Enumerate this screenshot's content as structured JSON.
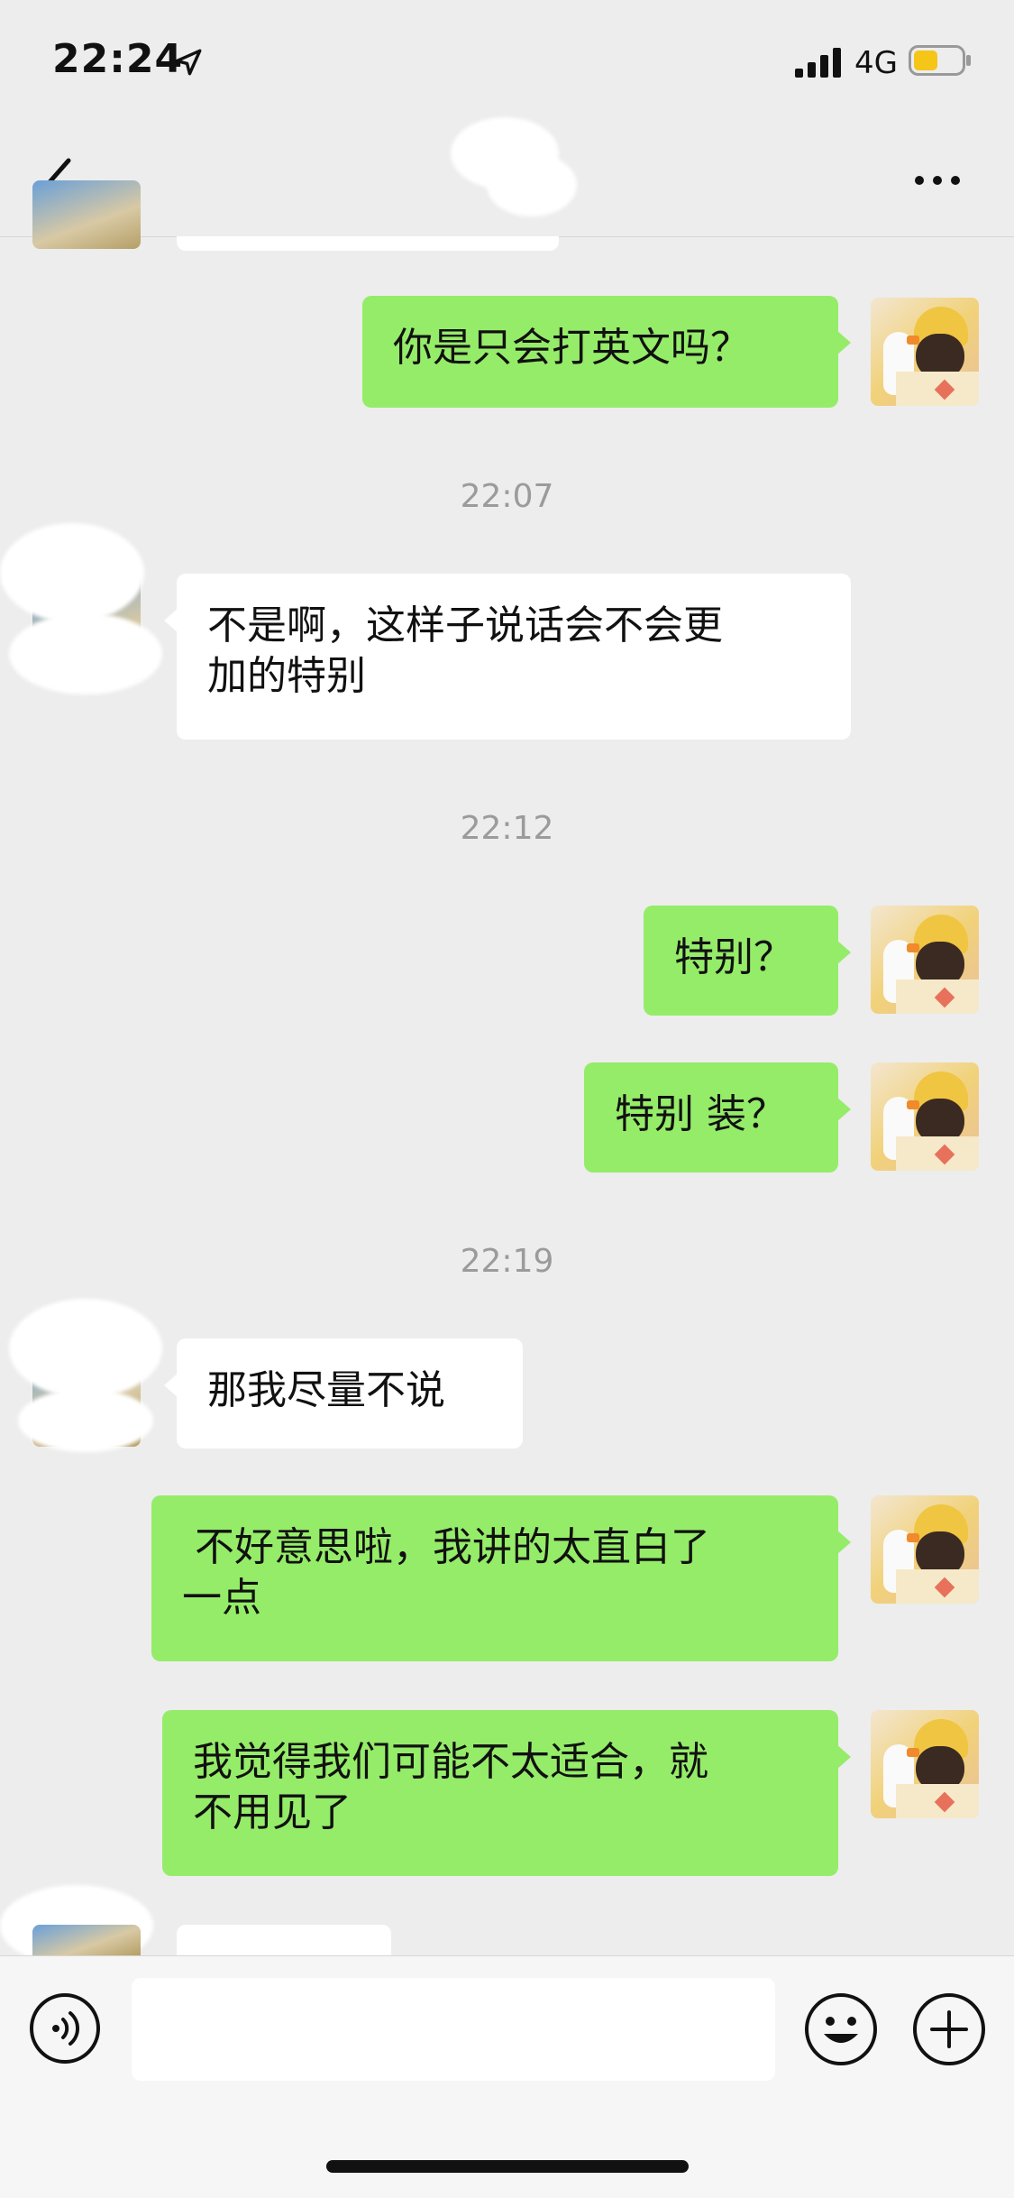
{
  "status_bar": {
    "time": "22:24",
    "network": "4G"
  },
  "nav": {
    "title": ""
  },
  "messages": [
    {
      "from": "me",
      "text": "你是只会打英文吗？"
    },
    {
      "type": "time",
      "text": "22:07"
    },
    {
      "from": "other",
      "text": "不是啊，这样子说话会不会更\n加的特别"
    },
    {
      "type": "time",
      "text": "22:12"
    },
    {
      "from": "me",
      "text": "特别？"
    },
    {
      "from": "me",
      "text": "特别 装？"
    },
    {
      "type": "time",
      "text": "22:19"
    },
    {
      "from": "other",
      "text": "那我尽量不说"
    },
    {
      "from": "me",
      "text": " 不好意思啦，我讲的太直白了\n一点"
    },
    {
      "from": "me",
      "text": "我觉得我们可能不太适合，就\n不用见了"
    }
  ],
  "input": {
    "value": "",
    "placeholder": ""
  },
  "icons": {
    "back": "chevron-left-icon",
    "more": "more-dots-icon",
    "voice": "voice-icon",
    "emoji": "emoji-icon",
    "plus": "plus-icon"
  },
  "colors": {
    "bubble_me": "#95ec69",
    "bubble_other": "#ffffff",
    "background": "#ededed"
  }
}
